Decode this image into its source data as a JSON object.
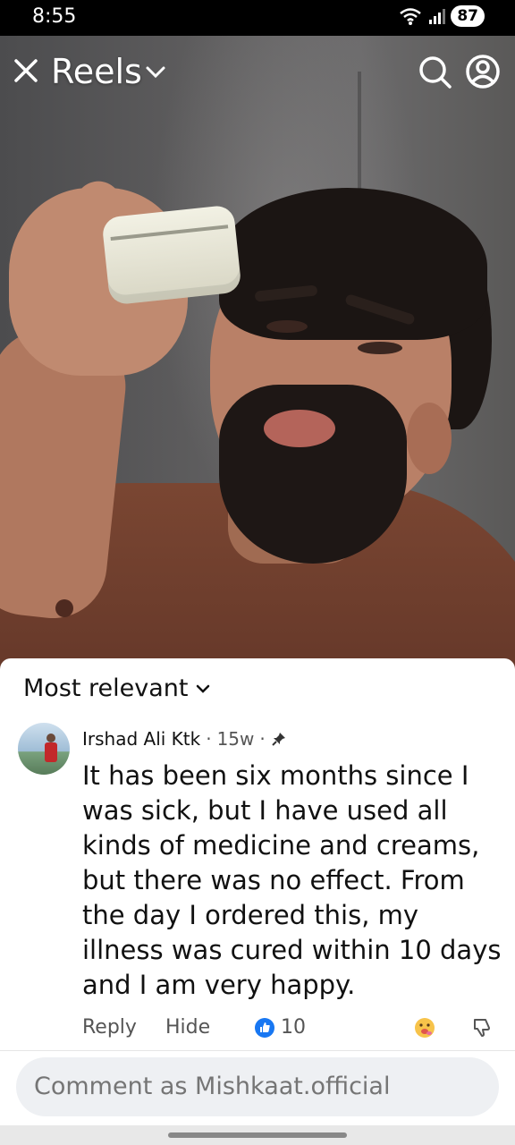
{
  "status_bar": {
    "time": "8:55",
    "battery": "87"
  },
  "header": {
    "title": "Reels"
  },
  "comments": {
    "sort_label": "Most relevant",
    "items": [
      {
        "author": "Irshad Ali Ktk",
        "time": "15w",
        "text": "It has been six months since I was sick, but I have used all kinds of medicine and creams, but there was no effect. From the day I ordered this, my illness was cured within 10 days and I am very happy.",
        "reply_label": "Reply",
        "hide_label": "Hide",
        "like_count": "10"
      }
    ],
    "input_placeholder": "Comment as Mishkaat.official"
  },
  "colors": {
    "like_blue": "#1877f2",
    "sheet_bg": "#ffffff",
    "input_bg": "#eef0f3"
  },
  "icons": [
    "close-icon",
    "chevron-down-icon",
    "search-icon",
    "profile-icon",
    "pin-icon",
    "like-icon",
    "reaction-icon",
    "dislike-icon",
    "wifi-icon",
    "signal-icon"
  ]
}
